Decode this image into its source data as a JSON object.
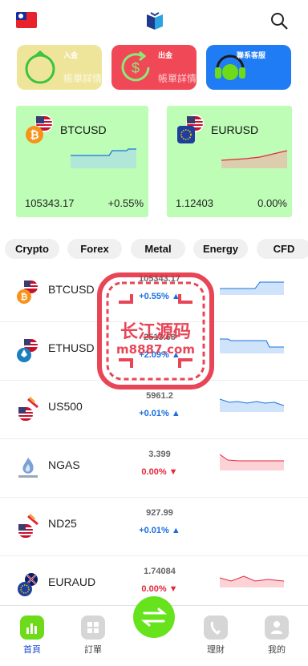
{
  "header": {
    "flag_icon": "taiwan-flag",
    "logo_icon": "app-logo",
    "search_icon": "search-icon"
  },
  "actions": [
    {
      "title": "入金",
      "subtitle": "帳單詳情",
      "icon": "wallet-icon",
      "color": "#efe59a"
    },
    {
      "title": "出金",
      "subtitle": "帳單詳情",
      "icon": "dollar-refresh-icon",
      "color": "#f04856"
    },
    {
      "title": "聯系客服",
      "subtitle": "",
      "icon": "headset-icon",
      "color": "#1f7cf4"
    }
  ],
  "featured": [
    {
      "symbol": "BTCUSD",
      "price": "105343.17",
      "change": "+0.55%"
    },
    {
      "symbol": "EURUSD",
      "price": "1.12403",
      "change": "0.00%"
    }
  ],
  "tabs": [
    "Crypto",
    "Forex",
    "Metal",
    "Energy",
    "CFD"
  ],
  "rows": [
    {
      "symbol": "BTCUSD",
      "price": "105343.17",
      "change": "+0.55%",
      "dir": "up"
    },
    {
      "symbol": "ETHUSD",
      "price": "2513.63",
      "change": "+2.09%",
      "dir": "up"
    },
    {
      "symbol": "US500",
      "price": "5961.2",
      "change": "+0.01%",
      "dir": "up"
    },
    {
      "symbol": "NGAS",
      "price": "3.399",
      "change": "0.00%",
      "dir": "down"
    },
    {
      "symbol": "ND25",
      "price": "927.99",
      "change": "+0.01%",
      "dir": "up"
    },
    {
      "symbol": "EURAUD",
      "price": "1.74084",
      "change": "0.00%",
      "dir": "down"
    }
  ],
  "watermark": {
    "line1": "长江源码",
    "line2": "m8887.com"
  },
  "nav": [
    {
      "label": "首頁",
      "icon": "chart-bars-icon",
      "active": true
    },
    {
      "label": "訂單",
      "icon": "grid-icon",
      "active": false
    },
    {
      "label": "",
      "icon": "swap-arrows-icon",
      "active": false
    },
    {
      "label": "理財",
      "icon": "phone-icon",
      "active": false
    },
    {
      "label": "我的",
      "icon": "user-icon",
      "active": false
    }
  ],
  "colors": {
    "up": "#1a6fe0",
    "down": "#e5263a",
    "feature_bg": "#bdfdb5",
    "accent_green": "#66e31c"
  }
}
